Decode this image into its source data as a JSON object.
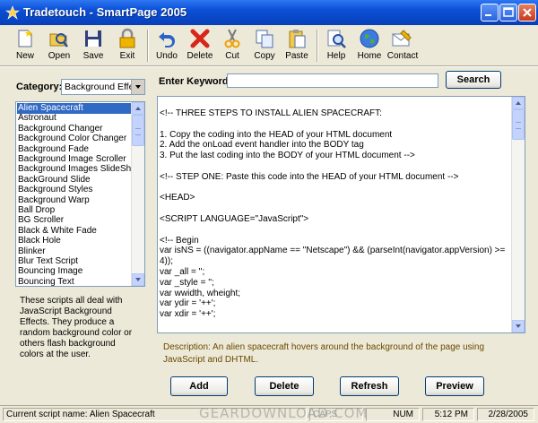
{
  "window": {
    "title": "Tradetouch - SmartPage 2005"
  },
  "toolbar": {
    "new": "New",
    "open": "Open",
    "save": "Save",
    "exit": "Exit",
    "undo": "Undo",
    "delete": "Delete",
    "cut": "Cut",
    "copy": "Copy",
    "paste": "Paste",
    "help": "Help",
    "home": "Home",
    "contact": "Contact"
  },
  "category": {
    "label": "Category:",
    "selected": "Background Effect"
  },
  "script_list": {
    "items": [
      "Alien Spacecraft",
      "Astronaut",
      "Background Changer",
      "Background Color Changer",
      "Background Fade",
      "Background Image Scroller",
      "Background Images SlideShow",
      "BackGround Slide",
      "Background Styles",
      "Background Warp",
      "Ball Drop",
      "BG Scroller",
      "Black & White Fade",
      "Black Hole",
      "Blinker",
      "Blur Text Script",
      "Bouncing Image",
      "Bouncing Text"
    ],
    "selected_index": 0
  },
  "category_description": "These scripts all deal with JavaScript Background Effects. They produce a random background color or others flash background colors at the user.",
  "search": {
    "label": "Enter Keyword:",
    "value": "",
    "button": "Search"
  },
  "code_lines": [
    "<!-- THREE STEPS TO INSTALL ALIEN SPACECRAFT:",
    "",
    "  1.  Copy the coding into the HEAD of your HTML document",
    "  2.  Add the onLoad event handler into the BODY tag",
    "  3.  Put the last coding into the BODY of your HTML document  -->",
    "",
    "<!-- STEP ONE: Paste this code into the HEAD of your HTML document  -->",
    "",
    "<HEAD>",
    "",
    "<SCRIPT LANGUAGE=\"JavaScript\">",
    "",
    "<!-- Begin",
    "var isNS = ((navigator.appName == \"Netscape\") && (parseInt(navigator.appVersion) >=",
    "4));",
    "var _all = '';",
    "var _style = '';",
    "var wwidth, wheight;",
    "var ydir = '++';",
    "var xdir = '++';"
  ],
  "script_description": "Description: An alien spacecraft hovers around the background of the page using JavaScript and DHTML.",
  "actions": {
    "add": "Add",
    "delete": "Delete",
    "refresh": "Refresh",
    "preview": "Preview"
  },
  "status": {
    "script_name": "Current script name: Alien Spacecraft",
    "caps": "CAPS",
    "num": "NUM",
    "time": "5:12 PM",
    "date": "2/28/2005"
  },
  "watermark": "GEARDOWNLOAD.COM"
}
